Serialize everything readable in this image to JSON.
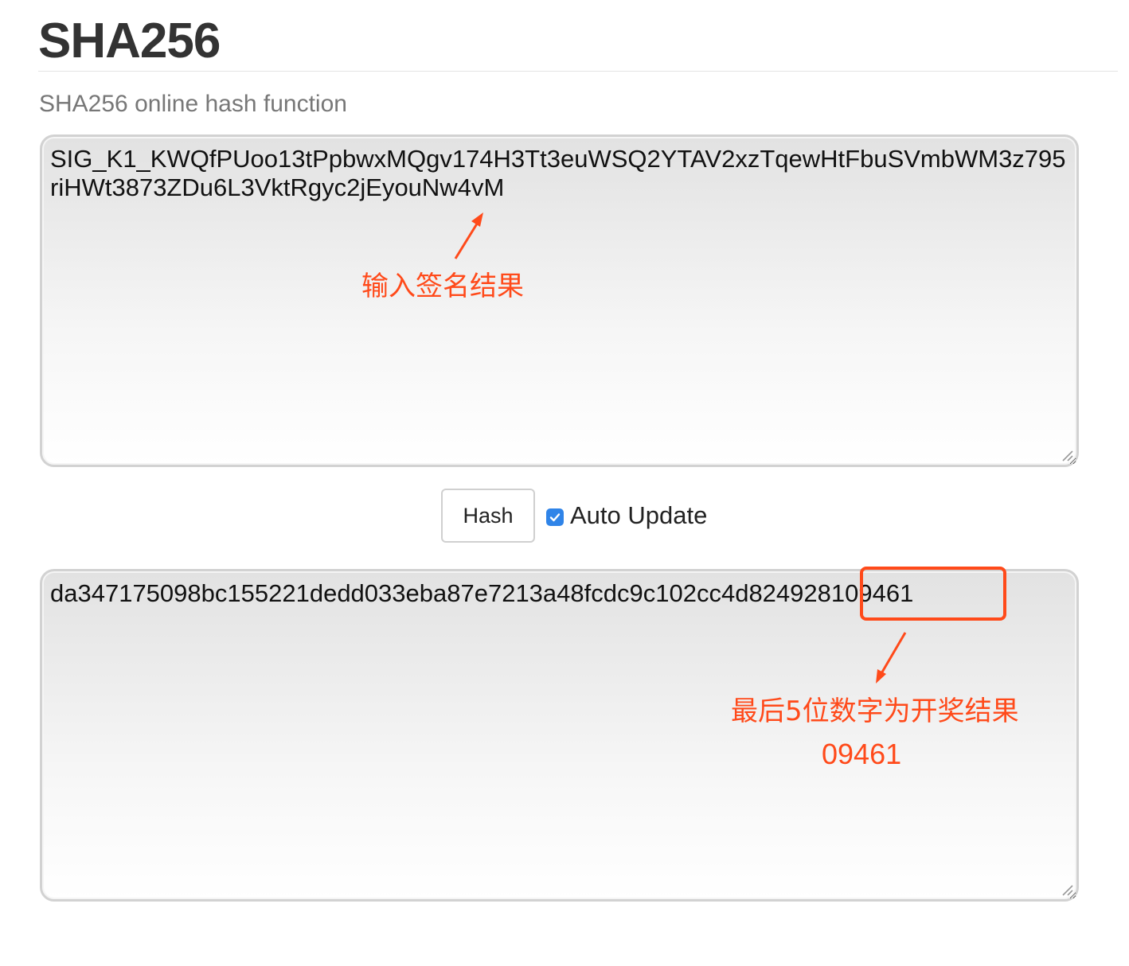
{
  "page": {
    "title": "SHA256",
    "subtitle": "SHA256 online hash function"
  },
  "input": {
    "value": "SIG_K1_KWQfPUoo13tPpbwxMQgv174H3Tt3euWSQ2YTAV2xzTqewHtFbuSVmbWM3z795riHWt3873ZDu6L3VktRgyc2jEyouNw4vM"
  },
  "controls": {
    "hash_label": "Hash",
    "auto_update_label": "Auto Update",
    "auto_update_checked": true
  },
  "output": {
    "value": "da347175098bc155221dedd033eba87e7213a48fcdc9c102cc4d82492810946 1"
  },
  "annotations": {
    "input_note": "输入签名结果",
    "output_note_line1": "最后5位数字为开奖结果",
    "output_note_line2": "09461",
    "color": "#ff4a1a"
  },
  "icons": {
    "checkbox": "checkmark-icon",
    "arrow": "arrow-icon",
    "resize": "resize-grip-icon"
  }
}
